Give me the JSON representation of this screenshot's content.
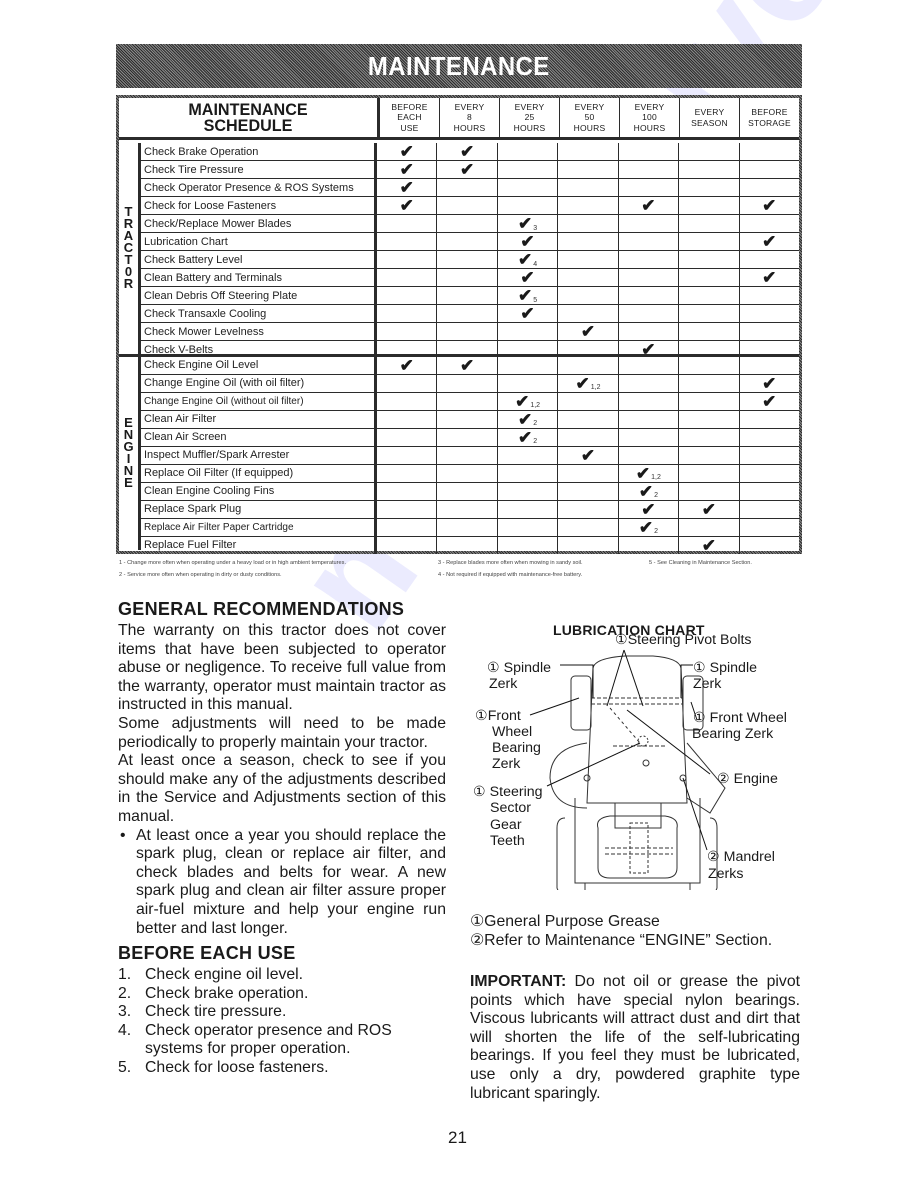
{
  "banner": {
    "title": "MAINTENANCE"
  },
  "schedule": {
    "title_line1": "MAINTENANCE",
    "title_line2": "SCHEDULE",
    "columns": [
      [
        "BEFORE",
        "EACH",
        "USE"
      ],
      [
        "EVERY",
        "8",
        "HOURS"
      ],
      [
        "EVERY",
        "25",
        "HOURS"
      ],
      [
        "EVERY",
        "50",
        "HOURS"
      ],
      [
        "EVERY",
        "100",
        "HOURS"
      ],
      [
        "EVERY",
        "SEASON",
        ""
      ],
      [
        "BEFORE",
        "STORAGE",
        ""
      ]
    ],
    "check_glyph": "✔",
    "sections": [
      {
        "label": "TRACT0R",
        "letters": [
          "T",
          "R",
          "A",
          "C",
          "T",
          "0",
          "R"
        ],
        "rows": [
          {
            "task": "Check Brake Operation",
            "cells": [
              "✔",
              "✔",
              "",
              "",
              "",
              "",
              ""
            ],
            "notes": [
              "",
              "",
              "",
              "",
              "",
              "",
              ""
            ]
          },
          {
            "task": "Check Tire Pressure",
            "cells": [
              "✔",
              "✔",
              "",
              "",
              "",
              "",
              ""
            ],
            "notes": [
              "",
              "",
              "",
              "",
              "",
              "",
              ""
            ]
          },
          {
            "task": "Check Operator Presence & ROS Systems",
            "cells": [
              "✔",
              "",
              "",
              "",
              "",
              "",
              ""
            ],
            "notes": [
              "",
              "",
              "",
              "",
              "",
              "",
              ""
            ]
          },
          {
            "task": "Check for Loose Fasteners",
            "cells": [
              "✔",
              "",
              "",
              "",
              "✔",
              "",
              "✔"
            ],
            "notes": [
              "",
              "",
              "",
              "",
              "",
              "",
              ""
            ]
          },
          {
            "task": "Check/Replace Mower Blades",
            "cells": [
              "",
              "",
              "✔",
              "",
              "",
              "",
              ""
            ],
            "notes": [
              "",
              "",
              "3",
              "",
              "",
              "",
              ""
            ]
          },
          {
            "task": "Lubrication Chart",
            "cells": [
              "",
              "",
              "✔",
              "",
              "",
              "",
              "✔"
            ],
            "notes": [
              "",
              "",
              "",
              "",
              "",
              "",
              ""
            ]
          },
          {
            "task": "Check Battery Level",
            "cells": [
              "",
              "",
              "✔",
              "",
              "",
              "",
              ""
            ],
            "notes": [
              "",
              "",
              "4",
              "",
              "",
              "",
              ""
            ]
          },
          {
            "task": "Clean Battery and Terminals",
            "cells": [
              "",
              "",
              "✔",
              "",
              "",
              "",
              "✔"
            ],
            "notes": [
              "",
              "",
              "",
              "",
              "",
              "",
              ""
            ]
          },
          {
            "task": "Clean Debris Off Steering Plate",
            "cells": [
              "",
              "",
              "✔",
              "",
              "",
              "",
              ""
            ],
            "notes": [
              "",
              "",
              "5",
              "",
              "",
              "",
              ""
            ]
          },
          {
            "task": "Check Transaxle Cooling",
            "cells": [
              "",
              "",
              "✔",
              "",
              "",
              "",
              ""
            ],
            "notes": [
              "",
              "",
              "",
              "",
              "",
              "",
              ""
            ]
          },
          {
            "task": "Check Mower Levelness",
            "cells": [
              "",
              "",
              "",
              "✔",
              "",
              "",
              ""
            ],
            "notes": [
              "",
              "",
              "",
              "",
              "",
              "",
              ""
            ]
          },
          {
            "task": "Check V-Belts",
            "cells": [
              "",
              "",
              "",
              "",
              "✔",
              "",
              ""
            ],
            "notes": [
              "",
              "",
              "",
              "",
              "",
              "",
              ""
            ]
          }
        ]
      },
      {
        "label": "ENGINE",
        "letters": [
          "E",
          "N",
          "G",
          "I",
          "N",
          "E"
        ],
        "rows": [
          {
            "task": "Check Engine Oil Level",
            "cells": [
              "✔",
              "✔",
              "",
              "",
              "",
              "",
              ""
            ],
            "notes": [
              "",
              "",
              "",
              "",
              "",
              "",
              ""
            ]
          },
          {
            "task": "Change Engine Oil (with oil filter)",
            "cells": [
              "",
              "",
              "",
              "✔",
              "",
              "",
              "✔"
            ],
            "notes": [
              "",
              "",
              "",
              "1,2",
              "",
              "",
              ""
            ]
          },
          {
            "task": "Change Engine Oil (without oil filter)",
            "cells": [
              "",
              "",
              "✔",
              "",
              "",
              "",
              "✔"
            ],
            "notes": [
              "",
              "",
              "1,2",
              "",
              "",
              "",
              ""
            ],
            "small": true
          },
          {
            "task": "Clean Air Filter",
            "cells": [
              "",
              "",
              "✔",
              "",
              "",
              "",
              ""
            ],
            "notes": [
              "",
              "",
              "2",
              "",
              "",
              "",
              ""
            ]
          },
          {
            "task": "Clean Air Screen",
            "cells": [
              "",
              "",
              "✔",
              "",
              "",
              "",
              ""
            ],
            "notes": [
              "",
              "",
              "2",
              "",
              "",
              "",
              ""
            ]
          },
          {
            "task": "Inspect Muffler/Spark Arrester",
            "cells": [
              "",
              "",
              "",
              "✔",
              "",
              "",
              ""
            ],
            "notes": [
              "",
              "",
              "",
              "",
              "",
              "",
              ""
            ]
          },
          {
            "task": "Replace Oil Filter (If equipped)",
            "cells": [
              "",
              "",
              "",
              "",
              "✔",
              "",
              ""
            ],
            "notes": [
              "",
              "",
              "",
              "",
              "1,2",
              "",
              ""
            ]
          },
          {
            "task": "Clean Engine Cooling Fins",
            "cells": [
              "",
              "",
              "",
              "",
              "✔",
              "",
              ""
            ],
            "notes": [
              "",
              "",
              "",
              "",
              "2",
              "",
              ""
            ]
          },
          {
            "task": "Replace Spark Plug",
            "cells": [
              "",
              "",
              "",
              "",
              "✔",
              "✔",
              ""
            ],
            "notes": [
              "",
              "",
              "",
              "",
              "",
              "",
              ""
            ]
          },
          {
            "task": "Replace Air Filter Paper Cartridge",
            "cells": [
              "",
              "",
              "",
              "",
              "✔",
              "",
              ""
            ],
            "notes": [
              "",
              "",
              "",
              "",
              "2",
              "",
              ""
            ],
            "small": true
          },
          {
            "task": "Replace Fuel Filter",
            "cells": [
              "",
              "",
              "",
              "",
              "",
              "✔",
              ""
            ],
            "notes": [
              "",
              "",
              "",
              "",
              "",
              "",
              ""
            ]
          }
        ]
      }
    ]
  },
  "footnotes": [
    "1 - Change more often when operating under a heavy load or in high ambient temperatures.",
    "2 - Service more often when operating in dirty or dusty conditions.",
    "3 - Replace blades more often when mowing in sandy soil.",
    "4 - Not required if equipped with maintenance-free battery.",
    "5 - See Cleaning in Maintenance Section."
  ],
  "general": {
    "title": "GENERAL RECOMMENDATIONS",
    "para1": "The warranty on this tractor does not cover items that have been subjected to operator abuse or negligence.  To receive full value from the warranty, operator must maintain tractor as instructed in this manual.",
    "para2": "Some adjustments will need to be made periodically to properly maintain your tractor.",
    "para3": "At least once a season, check to see if you should make any of the adjustments described in the Service and Adjustments section of this manual.",
    "bullet_glyph": "•",
    "bullet": "At least once a year you should replace the spark plug, clean or replace air filter, and check blades and belts for wear.  A new spark plug and clean air filter assure proper air-fuel mixture and help your engine run better and last longer."
  },
  "before_each_use": {
    "title": "BEFORE EACH USE",
    "items": [
      {
        "num": "1.",
        "text": "Check engine oil level."
      },
      {
        "num": "2.",
        "text": "Check brake operation."
      },
      {
        "num": "3.",
        "text": "Check tire pressure."
      },
      {
        "num": "4.",
        "text": "Check operator presence and ROS systems for proper operation."
      },
      {
        "num": "5.",
        "text": "Check for loose fasteners."
      }
    ]
  },
  "lubrication": {
    "title": "LUBRICATION CHART",
    "labels": {
      "steering_pivot": "①Steering Pivot Bolts",
      "spindle_left_1": "① Spindle",
      "spindle_left_2": "Zerk",
      "spindle_right_1": "① Spindle",
      "spindle_right_2": "Zerk",
      "front_left_1": "①Front",
      "front_left_2": "Wheel",
      "front_left_3": "Bearing",
      "front_left_4": "Zerk",
      "front_right_1": "① Front Wheel",
      "front_right_2": "Bearing Zerk",
      "engine": "② Engine",
      "steering_sector_1": "① Steering",
      "steering_sector_2": "Sector",
      "steering_sector_3": "Gear",
      "steering_sector_4": "Teeth",
      "mandrel_1": "② Mandrel",
      "mandrel_2": "Zerks"
    },
    "legend": [
      "①General Purpose Grease",
      "②Refer to Maintenance “ENGINE” Section."
    ]
  },
  "important": {
    "label": "IMPORTANT:",
    "text": " Do not oil or grease the pivot points which have special nylon bearings. Viscous lubricants will attract dust and dirt that will shorten the life of the self-lubricating bearings. If you feel they must be lubricated, use only a dry, powdered graphite type lubricant sparingly."
  },
  "page_number": "21",
  "watermark": "manualsive.com"
}
